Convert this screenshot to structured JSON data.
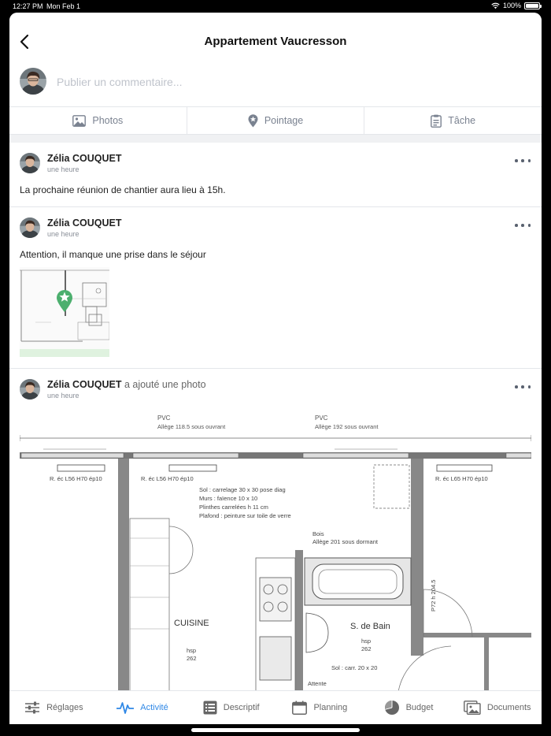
{
  "status": {
    "time": "12:27 PM",
    "date": "Mon Feb 1",
    "battery_text": "100%",
    "battery_level": 1.0
  },
  "header": {
    "title": "Appartement Vaucresson"
  },
  "composer": {
    "placeholder": "Publier un commentaire..."
  },
  "actions": [
    {
      "label": "Photos",
      "icon": "image-icon"
    },
    {
      "label": "Pointage",
      "icon": "location-pin-icon"
    },
    {
      "label": "Tâche",
      "icon": "clipboard-icon"
    }
  ],
  "posts": [
    {
      "author": "Zélia COUQUET",
      "verb": "",
      "time": "une heure",
      "text": "La prochaine réunion de chantier aura lieu à 15h."
    },
    {
      "author": "Zélia COUQUET",
      "verb": "",
      "time": "une heure",
      "text": "Attention, il manque une prise dans le séjour"
    },
    {
      "author": "Zélia COUQUET",
      "verb": "a ajouté une photo",
      "time": "une heure",
      "text": ""
    }
  ],
  "floorplan": {
    "pvc_left": "PVC",
    "pvc_left_sub": "Allège 118.5 sous ouvrant",
    "pvc_right": "PVC",
    "pvc_right_sub": "Allège 192 sous ouvrant",
    "radiator_left": "R. éc L56 H70 ép10",
    "radiator_mid": "R. éc L56 H70 ép10",
    "radiator_right": "R. éc L65 H70 ép10",
    "spec_1": "Sol : carrelage 30 x 30 pose diag",
    "spec_2": "Murs : faïence 10 x 10",
    "spec_3": "Plinthes carrelées h 11 cm",
    "spec_4": "Plafond : peinture sur toile de verre",
    "bois": "Bois",
    "bois_sub": "Allège 201 sous dormant",
    "kitchen": "CUISINE",
    "kitchen_hsp": "hsp",
    "kitchen_hsp_val": "262",
    "bath": "S. de Bain",
    "bath_hsp": "hsp",
    "bath_hsp_val": "262",
    "bath_floor": "Sol : carr. 20 x 20",
    "door": "P72 h 204.5",
    "attente": "Attente"
  },
  "tabs": [
    {
      "label": "Réglages",
      "icon": "sliders-icon",
      "active": false
    },
    {
      "label": "Activité",
      "icon": "activity-icon",
      "active": true
    },
    {
      "label": "Descriptif",
      "icon": "list-icon",
      "active": false
    },
    {
      "label": "Planning",
      "icon": "calendar-icon",
      "active": false
    },
    {
      "label": "Budget",
      "icon": "pie-chart-icon",
      "active": false
    },
    {
      "label": "Documents",
      "icon": "documents-icon",
      "active": false
    }
  ],
  "colors": {
    "accent": "#2f88e6",
    "pin": "#4caf6e"
  }
}
